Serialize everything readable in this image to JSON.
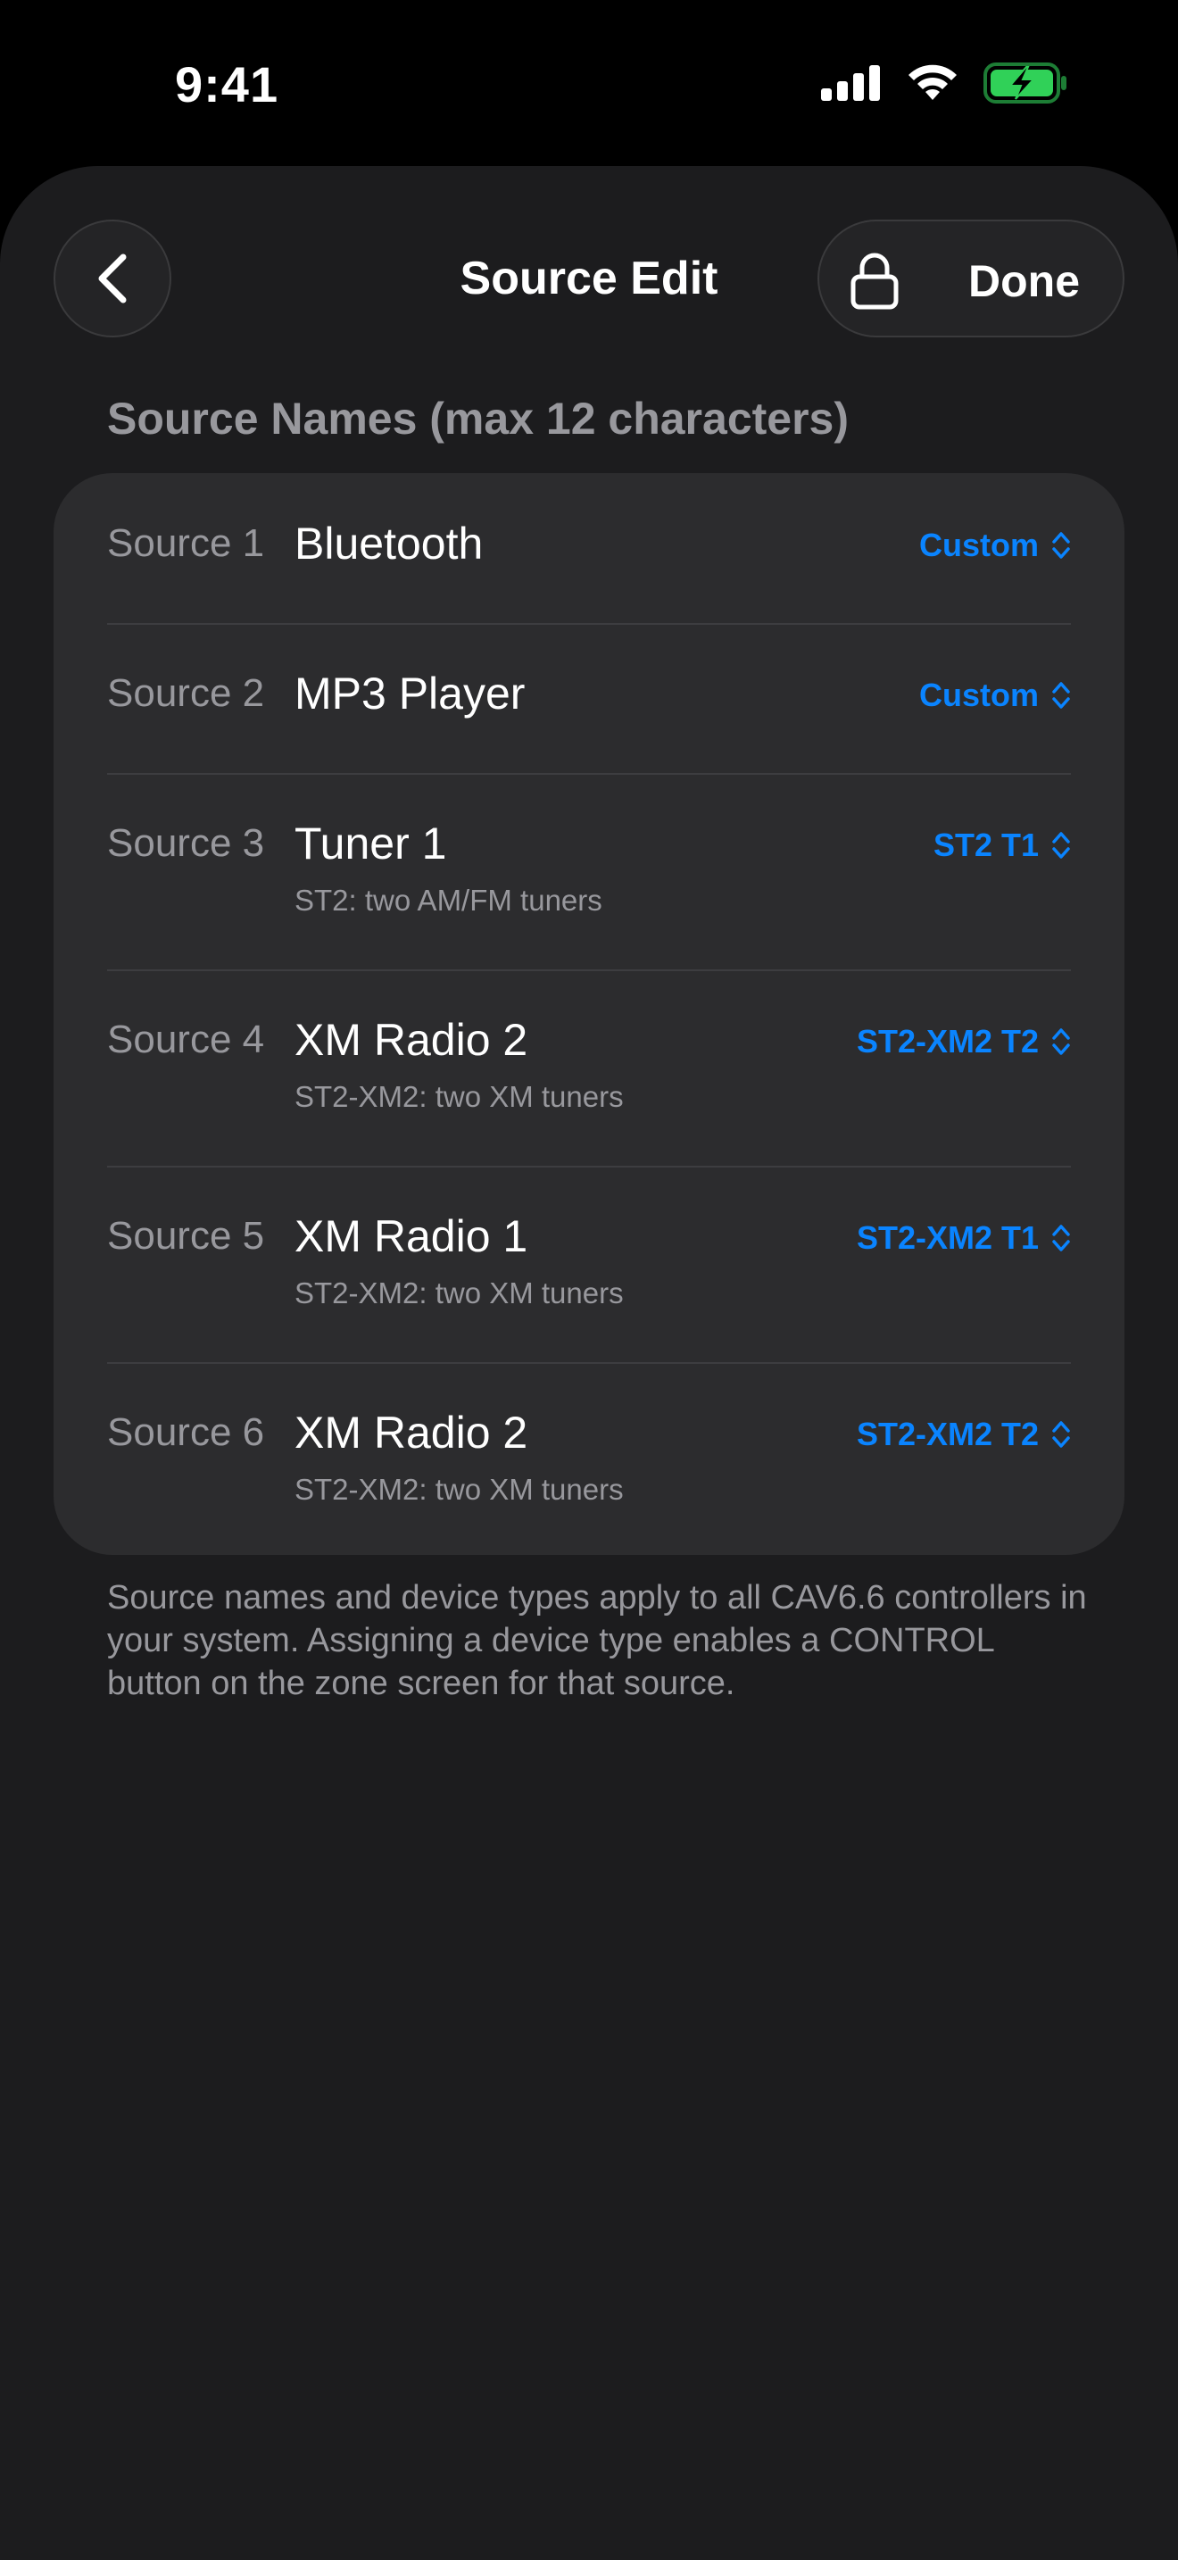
{
  "status_bar": {
    "time": "9:41",
    "icons": [
      "cellular-signal-icon",
      "wifi-icon",
      "battery-charging-icon"
    ],
    "battery_color": "#30d158"
  },
  "header": {
    "back_icon": "chevron-left-icon",
    "title": "Source Edit",
    "lock_icon": "lock-icon",
    "done_label": "Done"
  },
  "section": {
    "title": "Source Names (max 12 characters)"
  },
  "sources": [
    {
      "label": "Source 1",
      "name": "Bluetooth",
      "subtitle": "",
      "device_type": "Custom"
    },
    {
      "label": "Source 2",
      "name": "MP3 Player",
      "subtitle": "",
      "device_type": "Custom"
    },
    {
      "label": "Source 3",
      "name": "Tuner 1",
      "subtitle": "ST2: two AM/FM tuners",
      "device_type": "ST2 T1"
    },
    {
      "label": "Source 4",
      "name": "XM Radio 2",
      "subtitle": "ST2-XM2: two XM tuners",
      "device_type": "ST2-XM2 T2"
    },
    {
      "label": "Source 5",
      "name": "XM Radio 1",
      "subtitle": "ST2-XM2: two XM tuners",
      "device_type": "ST2-XM2 T1"
    },
    {
      "label": "Source 6",
      "name": "XM Radio 2",
      "subtitle": "ST2-XM2: two XM tuners",
      "device_type": "ST2-XM2 T2"
    }
  ],
  "footer": {
    "note": "Source names and device types apply to all CAV6.6 controllers in your system. Assigning a device type enables a CONTROL button on the zone screen for that source."
  },
  "colors": {
    "accent": "#0a84ff",
    "background": "#1c1c1e",
    "card": "#2c2c2e"
  }
}
